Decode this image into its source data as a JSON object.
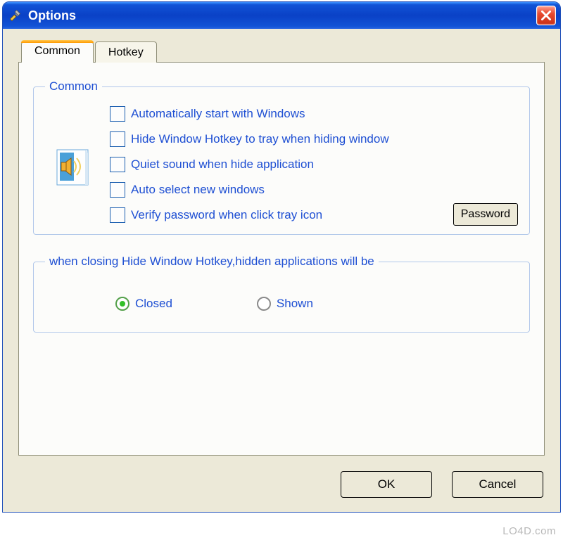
{
  "window": {
    "title": "Options"
  },
  "tabs": {
    "common": "Common",
    "hotkey": "Hotkey"
  },
  "group_common": {
    "legend": "Common",
    "items": [
      "Automatically start with Windows",
      "Hide Window Hotkey to tray when hiding window",
      "Quiet sound when hide application",
      "Auto select new windows",
      "Verify password when click tray icon"
    ],
    "password_btn": "Password"
  },
  "group_closing": {
    "legend": "when closing Hide Window Hotkey,hidden applications will be",
    "closed": "Closed",
    "shown": "Shown"
  },
  "buttons": {
    "ok": "OK",
    "cancel": "Cancel"
  },
  "watermark": "LO4D.com"
}
